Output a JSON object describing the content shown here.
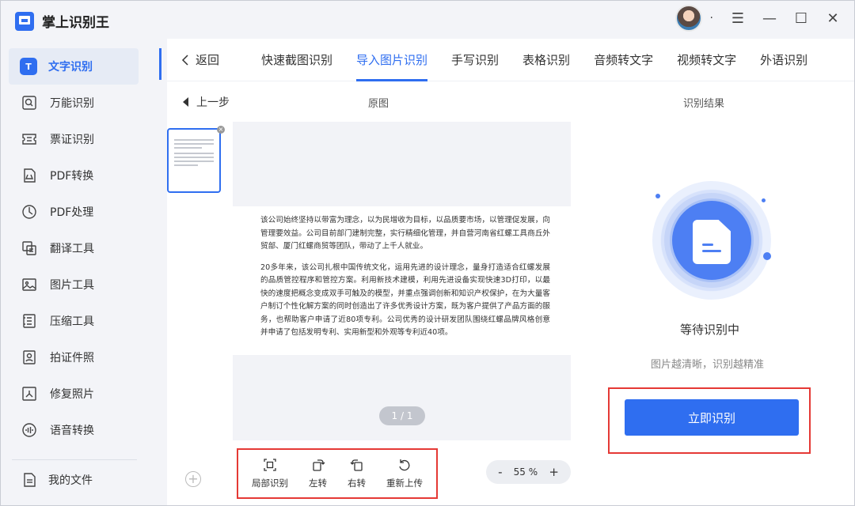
{
  "app": {
    "title": "掌上识别王"
  },
  "sidebar": {
    "items": [
      {
        "label": "文字识别",
        "icon": "text-recognition-icon",
        "active": true
      },
      {
        "label": "万能识别",
        "icon": "universal-scan-icon"
      },
      {
        "label": "票证识别",
        "icon": "ticket-icon"
      },
      {
        "label": "PDF转换",
        "icon": "pdf-convert-icon"
      },
      {
        "label": "PDF处理",
        "icon": "pdf-process-icon"
      },
      {
        "label": "翻译工具",
        "icon": "translate-icon"
      },
      {
        "label": "图片工具",
        "icon": "image-icon"
      },
      {
        "label": "压缩工具",
        "icon": "compress-icon"
      },
      {
        "label": "拍证件照",
        "icon": "id-photo-icon"
      },
      {
        "label": "修复照片",
        "icon": "repair-photo-icon"
      },
      {
        "label": "语音转换",
        "icon": "voice-icon"
      }
    ],
    "active_icon_letter": "T",
    "my_files": "我的文件"
  },
  "titlebar": {
    "dot": "·",
    "menu": "☰",
    "minimize": "—",
    "maximize": "☐",
    "close": "✕"
  },
  "tabs": {
    "back": "返回",
    "items": [
      "快速截图识别",
      "导入图片识别",
      "手写识别",
      "表格识别",
      "音频转文字",
      "视频转文字",
      "外语识别"
    ],
    "active_index": 1
  },
  "workspace": {
    "prev_step": "上一步",
    "original_label": "原图",
    "result_label": "识别结果",
    "doc_paragraphs": [
      "该公司始终坚持以带富为理念，以为民增收为目标，以品质要市场，以管理促发展，向管理要效益。公司目前部门建制完整，实行精细化管理，并自营河南省红螺工具商丘外贸部、厦门红螺商贸等团队，带动了上千人就业。",
      "20多年来，该公司扎根中国传统文化，运用先进的设计理念，量身打造适合红螺发展的品质管控程序和管控方案。利用新技术建模，利用先进设备实现快速3D打印，以最快的速度把概念变成双手可触及的模型，并重点强调创新和知识产权保护，在为大量客户制订个性化解方案的同时创造出了许多优秀设计方案，既为客户提供了产品方面的服务，也帮助客户申请了近80项专利。公司优秀的设计研发团队围绕红螺品牌风格创意并申请了包括发明专利、实用新型和外观等专利近40项。"
    ],
    "page_indicator": "1 / 1",
    "tools": [
      {
        "label": "局部识别",
        "icon": "crop-scan-icon"
      },
      {
        "label": "左转",
        "icon": "rotate-left-icon"
      },
      {
        "label": "右转",
        "icon": "rotate-right-icon"
      },
      {
        "label": "重新上传",
        "icon": "reupload-icon"
      }
    ],
    "zoom": {
      "minus": "-",
      "value": "55 %",
      "plus": "+"
    },
    "status": "等待识别中",
    "hint": "图片越清晰，识别越精准",
    "recognize_button": "立即识别"
  }
}
